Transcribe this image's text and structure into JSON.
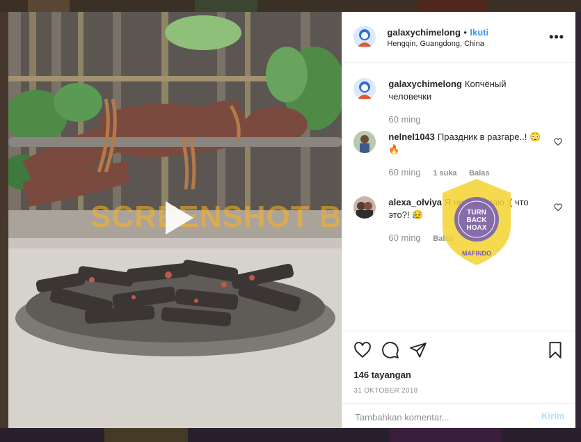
{
  "post": {
    "username": "galaxychimelong",
    "separator": "•",
    "follow_label": "Ikuti",
    "location": "Hengqin, Guangdong, China",
    "more_icon": "more-horizontal-icon",
    "caption": "Копчёный человечки",
    "caption_time": "60 ming"
  },
  "comments": [
    {
      "username": "nelnel1043",
      "text": "Праздник в разгаре..! 😳🔥",
      "time": "60 ming",
      "likes": "1 suka",
      "reply": "Balas"
    },
    {
      "username": "alexa_olviya",
      "text": "Я не понимаю :( что это?! 😥",
      "time": "60 ming",
      "reply": "Balas"
    }
  ],
  "stats": {
    "views": "146 tayangan",
    "date": "31 OKTOBER 2018"
  },
  "composer": {
    "placeholder": "Tambahkan komentar...",
    "post_label": "Kirim"
  },
  "watermark": {
    "text": "SCREENSHOT BY",
    "badge_center": "TURN BACK HOAX",
    "badge_ring": "MASYARAKAT ANTI FITNAH INDONESIA",
    "badge_bottom": "MAFINDO"
  },
  "colors": {
    "accent": "#3897f0",
    "post_button_disabled": "#b2dffc",
    "badge_yellow": "#f3d22f",
    "badge_purple": "#7a5fb4"
  }
}
